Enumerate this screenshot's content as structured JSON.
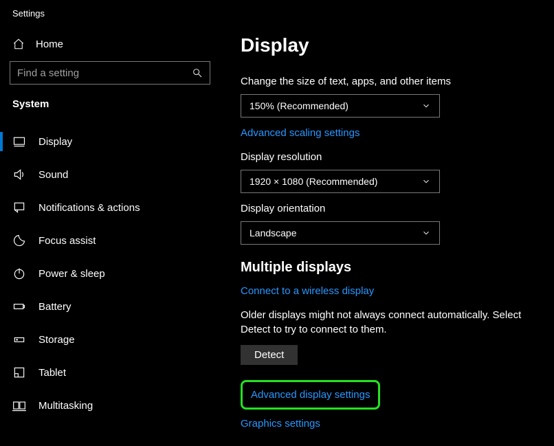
{
  "app_title": "Settings",
  "home_label": "Home",
  "search_placeholder": "Find a setting",
  "category": "System",
  "nav": [
    {
      "icon": "display",
      "label": "Display",
      "active": true
    },
    {
      "icon": "sound",
      "label": "Sound",
      "active": false
    },
    {
      "icon": "notifications",
      "label": "Notifications & actions",
      "active": false
    },
    {
      "icon": "focus",
      "label": "Focus assist",
      "active": false
    },
    {
      "icon": "power",
      "label": "Power & sleep",
      "active": false
    },
    {
      "icon": "battery",
      "label": "Battery",
      "active": false
    },
    {
      "icon": "storage",
      "label": "Storage",
      "active": false
    },
    {
      "icon": "tablet",
      "label": "Tablet",
      "active": false
    },
    {
      "icon": "multitasking",
      "label": "Multitasking",
      "active": false
    }
  ],
  "main": {
    "heading": "Display",
    "scale_label": "Change the size of text, apps, and other items",
    "scale_value": "150% (Recommended)",
    "adv_scaling_link": "Advanced scaling settings",
    "resolution_label": "Display resolution",
    "resolution_value": "1920 × 1080 (Recommended)",
    "orientation_label": "Display orientation",
    "orientation_value": "Landscape",
    "multi_heading": "Multiple displays",
    "connect_link": "Connect to a wireless display",
    "detect_desc": "Older displays might not always connect automatically. Select Detect to try to connect to them.",
    "detect_button": "Detect",
    "adv_display_link": "Advanced display settings",
    "graphics_link": "Graphics settings"
  }
}
